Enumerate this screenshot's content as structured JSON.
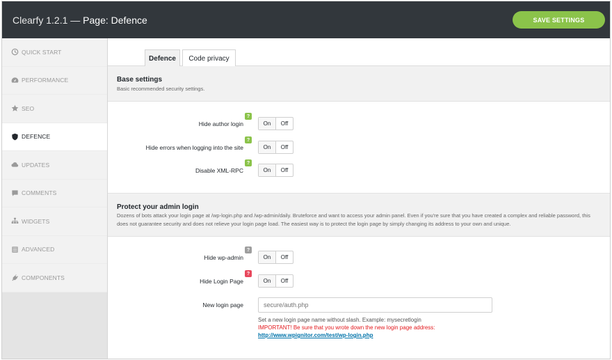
{
  "header": {
    "app_name": "Clearfy 1.2.1 —",
    "page_title": "Page: Defence",
    "save_label": "SAVE SETTINGS"
  },
  "sidebar": {
    "items": [
      {
        "label": "QUICK START",
        "icon": "clock-icon"
      },
      {
        "label": "PERFORMANCE",
        "icon": "speedometer-icon"
      },
      {
        "label": "SEO",
        "icon": "star-icon"
      },
      {
        "label": "DEFENCE",
        "icon": "shield-icon",
        "active": true
      },
      {
        "label": "UPDATES",
        "icon": "cloud-icon"
      },
      {
        "label": "COMMENTS",
        "icon": "comment-icon"
      },
      {
        "label": "WIDGETS",
        "icon": "sitemap-icon"
      },
      {
        "label": "ADVANCED",
        "icon": "list-icon"
      },
      {
        "label": "COMPONENTS",
        "icon": "plug-icon"
      }
    ]
  },
  "tabs": [
    {
      "label": "Defence",
      "active": true
    },
    {
      "label": "Code privacy"
    }
  ],
  "base_settings": {
    "title": "Base settings",
    "description": "Basic recommended security settings.",
    "rows": [
      {
        "label": "Hide author login",
        "on": "On",
        "off": "Off",
        "help": "?"
      },
      {
        "label": "Hide errors when logging into the site",
        "on": "On",
        "off": "Off",
        "help": "?"
      },
      {
        "label": "Disable XML-RPC",
        "on": "On",
        "off": "Off",
        "help": "?"
      }
    ]
  },
  "protect_login": {
    "title": "Protect your admin login",
    "description": "Dozens of bots attack your login page at /wp-login.php and /wp-admin/daily. Bruteforce and want to access your admin panel. Even if you're sure that you have created a complex and reliable password, this does not guarantee security and does not relieve your login page load. The easiest way is to protect the login page by simply changing its address to your own and unique.",
    "rows": [
      {
        "label": "Hide wp-admin",
        "on": "On",
        "off": "Off",
        "help": "?"
      },
      {
        "label": "Hide Login Page",
        "on": "On",
        "off": "Off",
        "help": "?"
      }
    ],
    "new_login": {
      "label": "New login page",
      "placeholder": "secure/auth.php",
      "hint": "Set a new login page name without slash. Example: mysecretlogin",
      "warning": "IMPORTANT! Be sure that you wrote down the new login page address:",
      "link": "http://www.wpignitor.com/test/wp-login.php"
    }
  },
  "colors": {
    "accent": "#8bc34a",
    "topbar": "#32373c",
    "warning": "#e3191d",
    "link": "#0073aa"
  }
}
